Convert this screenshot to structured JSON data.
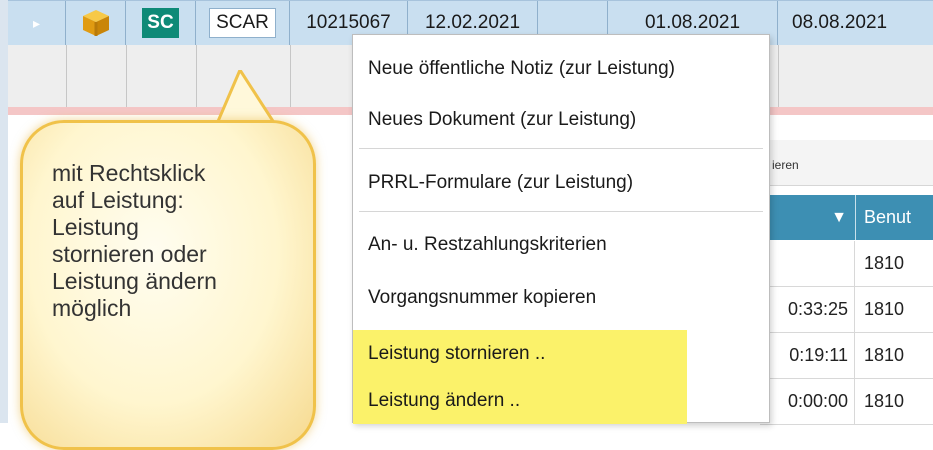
{
  "grid": {
    "expander_icon": "triangle-right-icon",
    "package_icon": "package-box-icon",
    "badge": "SC",
    "code": "SCAR",
    "col4": "10215067",
    "col5": "12.02.2021",
    "col7": "01.08.2021",
    "col8": "08.08.2021"
  },
  "background_table": {
    "toolbar_text": "ieren",
    "header_benutzer": "Benut",
    "rows": [
      {
        "time": "",
        "user": "1810"
      },
      {
        "time": "0:33:25",
        "user": "1810"
      },
      {
        "time": "0:19:11",
        "user": "1810"
      },
      {
        "time": "0:00:00",
        "user": "1810"
      }
    ]
  },
  "callout": {
    "lines": [
      "mit Rechtsklick",
      "auf Leistung:",
      "Leistung",
      "stornieren oder",
      "Leistung ändern",
      "möglich"
    ],
    "colors": {
      "fill": "#fff6cf",
      "border": "#f0c24a"
    }
  },
  "context_menu": {
    "items": [
      {
        "label": "Neue öffentliche Notiz (zur Leistung)"
      },
      {
        "label": "Neues Dokument (zur Leistung)"
      },
      {
        "label": "PRRL-Formulare (zur Leistung)"
      },
      {
        "label": "An- u. Restzahlungskriterien"
      },
      {
        "label": "Vorgangsnummer kopieren"
      },
      {
        "label": "Leistung stornieren .."
      },
      {
        "label": "Leistung ändern .."
      }
    ],
    "highlight_color": "#fbf26a"
  }
}
